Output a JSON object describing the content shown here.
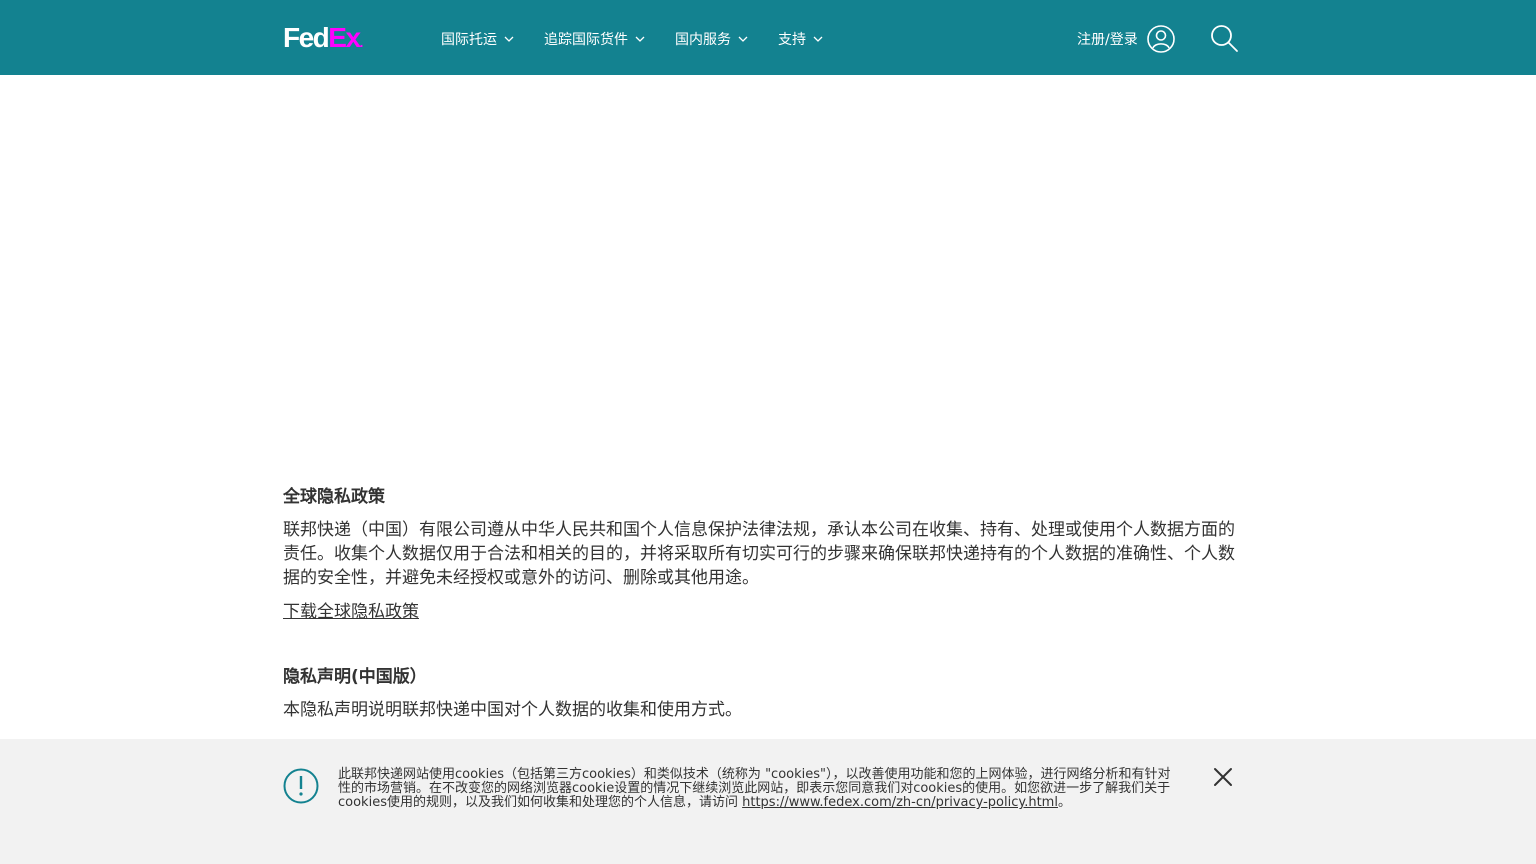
{
  "header": {
    "logo": {
      "fed": "Fed",
      "ex": "Ex",
      "dot": "."
    },
    "nav": [
      {
        "label": "国际托运"
      },
      {
        "label": "追踪国际货件"
      },
      {
        "label": "国内服务"
      },
      {
        "label": "支持"
      }
    ],
    "login_label": "注册/登录",
    "colors": {
      "background": "#138290",
      "text": "#ffffff",
      "logo_accent": "#ff00ff"
    },
    "icons": [
      "chevron-down-icon",
      "user-icon",
      "search-icon"
    ]
  },
  "main": {
    "sections": [
      {
        "title": "全球隐私政策",
        "body": "联邦快递（中国）有限公司遵从中华人民共和国个人信息保护法律法规，承认本公司在收集、持有、处理或使用个人数据方面的责任。收集个人数据仅用于合法和相关的目的，并将采取所有切实可行的步骤来确保联邦快递持有的个人数据的准确性、个人数据的安全性，并避免未经授权或意外的访问、删除或其他用途。",
        "link": "下载全球隐私政策"
      },
      {
        "title": "隐私声明(中国版）",
        "body": "本隐私声明说明联邦快递中国对个人数据的收集和使用方式。"
      }
    ]
  },
  "cookie_banner": {
    "text": "此联邦快递网站使用cookies（包括第三方cookies）和类似技术（统称为 \"cookies\"），以改善使用功能和您的上网体验，进行网络分析和有针对性的市场营销。在不改变您的网络浏览器cookie设置的情况下继续浏览此网站，即表示您同意我们对cookies的使用。如您欲进一步了解我们关于cookies使用的规则，以及我们如何收集和处理您的个人信息，请访问 ",
    "link": "https://www.fedex.com/zh-cn/privacy-policy.html",
    "suffix": "。",
    "icons": [
      "alert-icon",
      "close-icon"
    ],
    "colors": {
      "background": "#f2f2f2",
      "accent": "#138290"
    }
  }
}
